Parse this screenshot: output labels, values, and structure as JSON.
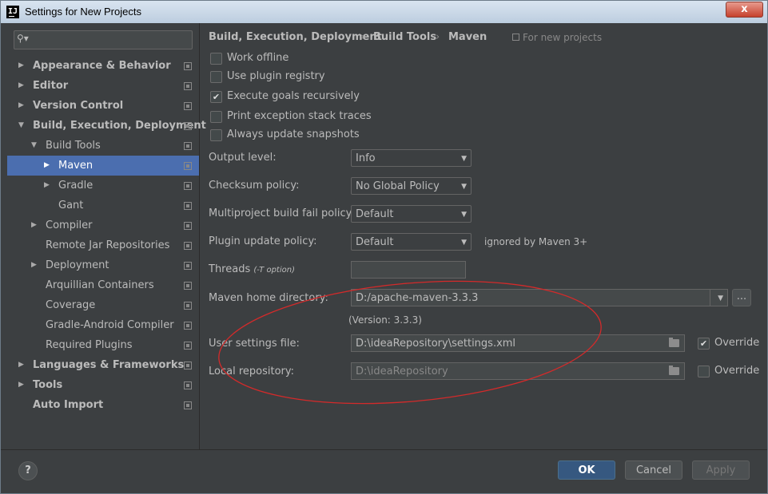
{
  "window": {
    "title": "Settings for New Projects",
    "app_icon_text": "IJ",
    "close_glyph": "x"
  },
  "sidebar": {
    "search_placeholder": "",
    "items": [
      {
        "label": "Appearance & Behavior",
        "arrow": "▶"
      },
      {
        "label": "Editor",
        "arrow": "▶"
      },
      {
        "label": "Version Control",
        "arrow": "▶"
      },
      {
        "label": "Build, Execution, Deployment",
        "arrow": "▼"
      },
      {
        "label": "Build Tools",
        "arrow": "▼"
      },
      {
        "label": "Maven",
        "arrow": "▶"
      },
      {
        "label": "Gradle",
        "arrow": "▶"
      },
      {
        "label": "Gant",
        "arrow": ""
      },
      {
        "label": "Compiler",
        "arrow": "▶"
      },
      {
        "label": "Remote Jar Repositories",
        "arrow": ""
      },
      {
        "label": "Deployment",
        "arrow": "▶"
      },
      {
        "label": "Arquillian Containers",
        "arrow": ""
      },
      {
        "label": "Coverage",
        "arrow": ""
      },
      {
        "label": "Gradle-Android Compiler",
        "arrow": ""
      },
      {
        "label": "Required Plugins",
        "arrow": ""
      },
      {
        "label": "Languages & Frameworks",
        "arrow": "▶"
      },
      {
        "label": "Tools",
        "arrow": "▶"
      },
      {
        "label": "Auto Import",
        "arrow": ""
      }
    ]
  },
  "breadcrumb": {
    "items": [
      "Build, Execution, Deployment",
      "Build Tools",
      "Maven"
    ],
    "separator": "›",
    "scope": "For new projects"
  },
  "checkboxes": [
    {
      "label": "Work offline",
      "checked": false
    },
    {
      "label": "Use plugin registry",
      "checked": false
    },
    {
      "label": "Execute goals recursively",
      "checked": true
    },
    {
      "label": "Print exception stack traces",
      "checked": false
    },
    {
      "label": "Always update snapshots",
      "checked": false
    }
  ],
  "check_glyph": "✔",
  "output_level": {
    "label": "Output level:",
    "value": "Info"
  },
  "checksum_policy": {
    "label": "Checksum policy:",
    "value": "No Global Policy"
  },
  "multiproject_policy": {
    "label": "Multiproject build fail policy:",
    "value": "Default"
  },
  "plugin_update_policy": {
    "label": "Plugin update policy:",
    "value": "Default",
    "note": "ignored by Maven 3+"
  },
  "threads": {
    "label": "Threads",
    "hint": "(-T option)",
    "value": ""
  },
  "maven_home": {
    "label": "Maven home directory:",
    "value": "D:/apache-maven-3.3.3",
    "version": "(Version: 3.3.3)",
    "browse": "..."
  },
  "user_settings": {
    "label": "User settings file:",
    "value": "D:\\ideaRepository\\settings.xml",
    "override_label": "Override",
    "override_checked": true
  },
  "local_repo": {
    "label": "Local repository:",
    "value": "D:\\ideaRepository",
    "override_label": "Override",
    "override_checked": false
  },
  "footer": {
    "help": "?",
    "ok": "OK",
    "cancel": "Cancel",
    "apply": "Apply"
  },
  "combo_arrow": "▼",
  "colors": {
    "selection": "#4b6eaf",
    "annotation": "#d42a2a",
    "background": "#3c3f41",
    "primary_button": "#365880"
  }
}
